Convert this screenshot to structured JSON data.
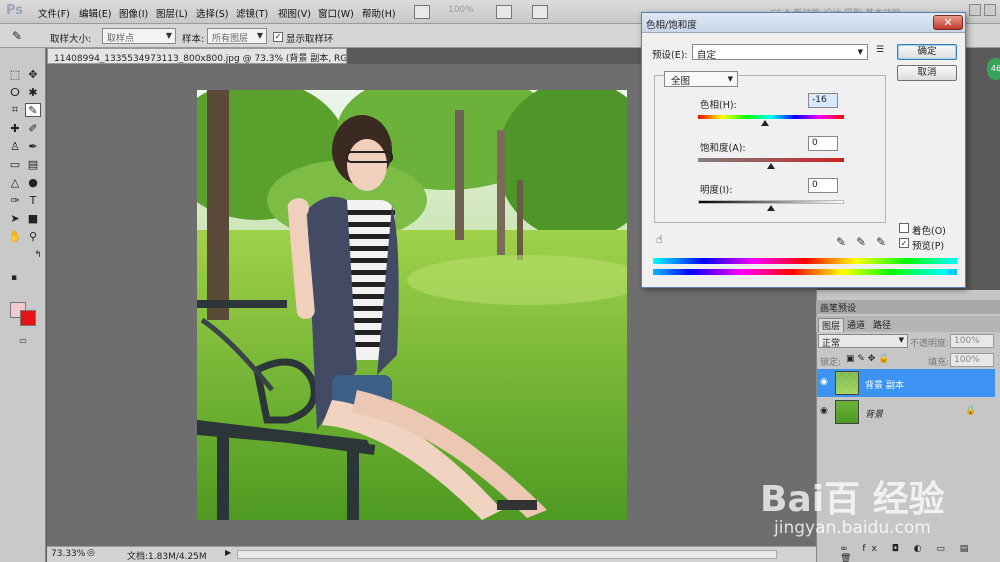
{
  "app": {
    "logo": "Ps"
  },
  "menu": [
    "文件(F)",
    "编辑(E)",
    "图像(I)",
    "图层(L)",
    "选择(S)",
    "滤镜(T)",
    "视图(V)",
    "窗口(W)",
    "帮助(H)"
  ],
  "menubar": {
    "zoom": "100%",
    "workspace": "CS 5 新功能   设计   摄影   基本功能"
  },
  "options": {
    "sample_size_label": "取样大小:",
    "sample_size_value": "取样点",
    "sample_label": "样本:",
    "sample_value": "所有图层",
    "show_ring_label": "显示取样环",
    "show_ring_checked": "✓"
  },
  "document": {
    "tab_title": "11408994_1335534973113_800x800.jpg @ 73.3% (背景 副本, RGB/8) *",
    "zoom": "73.33%",
    "doc_info": "文档:1.83M/4.25M"
  },
  "dialog": {
    "title": "色相/饱和度",
    "preset_label": "预设(E):",
    "preset_value": "自定",
    "ok": "确定",
    "cancel": "取消",
    "channel": "全图",
    "hue_label": "色相(H):",
    "hue_value": "-16",
    "saturation_label": "饱和度(A):",
    "saturation_value": "0",
    "lightness_label": "明度(I):",
    "lightness_value": "0",
    "colorize_label": "着色(O)",
    "preview_label": "预览(P)",
    "preview_checked": "✓"
  },
  "panels": {
    "brush_presets": "画笔预设",
    "layer_tabs": [
      "图层",
      "通道",
      "路径"
    ],
    "blend_mode": "正常",
    "opacity_label": "不透明度:",
    "opacity_value": "100%",
    "lock_label": "锁定:",
    "fill_label": "填充:",
    "fill_value": "100%",
    "badge": "46",
    "layers": [
      {
        "name": "背景 副本",
        "selected": true
      },
      {
        "name": "背景",
        "selected": false
      }
    ]
  },
  "watermark": {
    "brand": "Bai百 经验",
    "url": "jingyan.baidu.com"
  },
  "colors": {
    "foreground": "#f4c9cf",
    "background": "#e61414",
    "selection": "#3d93f2"
  }
}
